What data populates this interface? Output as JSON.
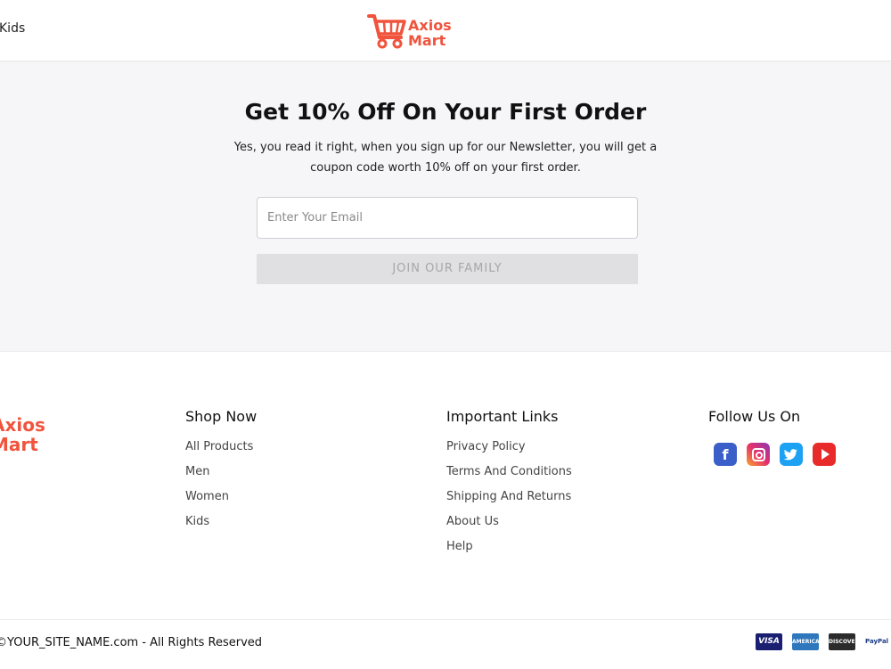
{
  "header": {
    "nav_kids": "Kids",
    "logo_line1": "Axios",
    "logo_line2": "Mart"
  },
  "newsletter": {
    "title": "Get 10% Off On Your First Order",
    "description": "Yes, you read it right, when you sign up for our Newsletter, you will get a coupon code worth 10% off on your first order.",
    "email_placeholder": "Enter Your Email",
    "email_value": "",
    "button_label": "JOIN OUR FAMILY"
  },
  "footer": {
    "logo_line1": "Axios",
    "logo_line2": "Mart",
    "shop": {
      "heading": "Shop Now",
      "items": [
        "All Products",
        "Men",
        "Women",
        "Kids"
      ]
    },
    "links": {
      "heading": "Important Links",
      "items": [
        "Privacy Policy",
        "Terms And Conditions",
        "Shipping And Returns",
        "About Us",
        "Help"
      ]
    },
    "follow": {
      "heading": "Follow Us On",
      "icons": [
        "facebook-icon",
        "instagram-icon",
        "twitter-icon",
        "youtube-icon"
      ]
    },
    "copyright": "©YOUR_SITE_NAME.com - All Rights Reserved",
    "payments": {
      "visa": "VISA",
      "amex": "AMERICAN EXPRESS",
      "discover": "DISCOVER",
      "paypal": "PayPal"
    }
  },
  "colors": {
    "brand": "#f0543d",
    "section_bg": "#f6f6f8",
    "button_bg": "#e0e0e2",
    "button_text": "#a7a7ab"
  }
}
